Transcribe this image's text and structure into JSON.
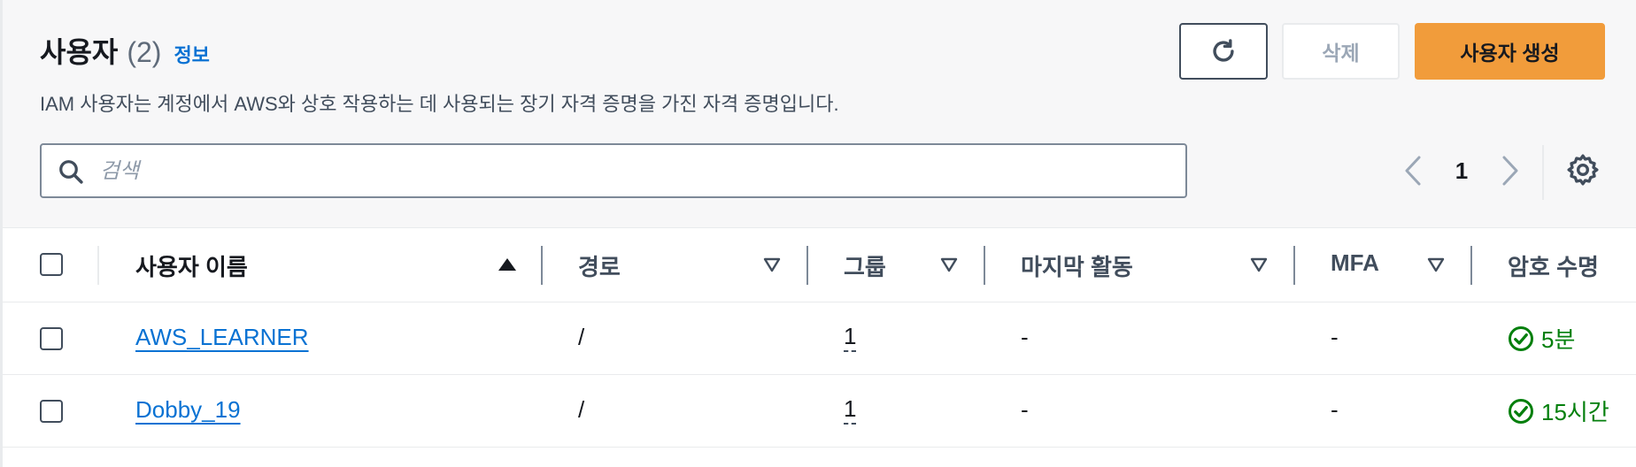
{
  "header": {
    "title": "사용자",
    "count": "(2)",
    "info_link": "정보",
    "description": "IAM 사용자는 계정에서 AWS와 상호 작용하는 데 사용되는 장기 자격 증명을 가진 자격 증명입니다."
  },
  "actions": {
    "refresh_icon": "refresh-icon",
    "delete_label": "삭제",
    "create_label": "사용자 생성"
  },
  "search": {
    "placeholder": "검색",
    "value": ""
  },
  "pagination": {
    "current_page": "1"
  },
  "table": {
    "columns": [
      {
        "label": "사용자 이름",
        "sort": "ascending"
      },
      {
        "label": "경로",
        "sort": "none"
      },
      {
        "label": "그룹",
        "sort": "none"
      },
      {
        "label": "마지막 활동",
        "sort": "none"
      },
      {
        "label": "MFA",
        "sort": "none"
      },
      {
        "label": "암호 수명",
        "sort": "none"
      }
    ],
    "rows": [
      {
        "user_name": "AWS_LEARNER",
        "path": "/",
        "groups": "1",
        "last_activity": "-",
        "mfa": "-",
        "password_age": "5분"
      },
      {
        "user_name": "Dobby_19",
        "path": "/",
        "groups": "1",
        "last_activity": "-",
        "mfa": "-",
        "password_age": "15시간"
      }
    ]
  },
  "colors": {
    "accent_orange": "#f19c3b",
    "link_blue": "#0972d3",
    "success_green": "#037f0c"
  }
}
